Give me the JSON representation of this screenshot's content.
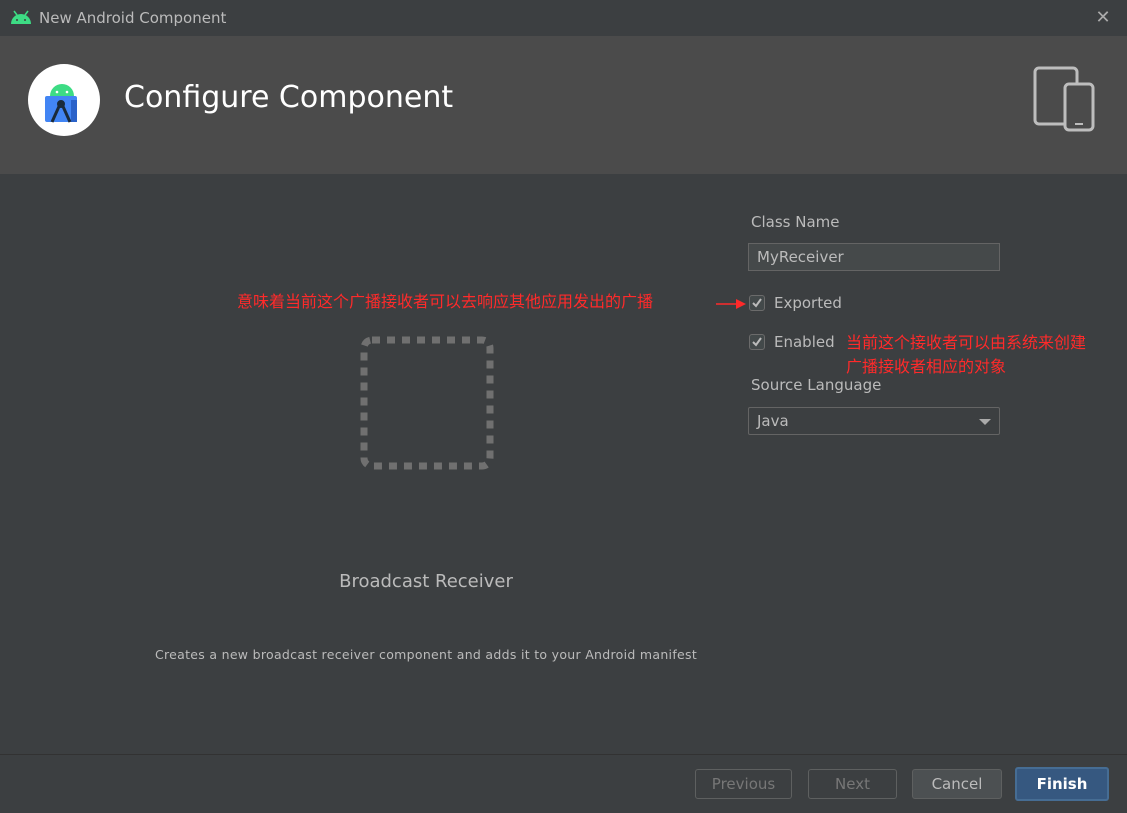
{
  "window": {
    "title": "New Android Component",
    "close_icon": "close-icon"
  },
  "header": {
    "title": "Configure Component"
  },
  "component": {
    "name": "Broadcast Receiver",
    "description": "Creates a new broadcast receiver component and adds it to your Android manifest"
  },
  "form": {
    "class_name_label": "Class Name",
    "class_name_value": "MyReceiver",
    "exported_label": "Exported",
    "exported_checked": true,
    "enabled_label": "Enabled",
    "enabled_checked": true,
    "source_language_label": "Source Language",
    "source_language_value": "Java"
  },
  "annotations": {
    "exported_note": "意味着当前这个广播接收者可以去响应其他应用发出的广播",
    "enabled_note_line1": "当前这个接收者可以由系统来创建",
    "enabled_note_line2": "广播接收者相应的对象",
    "color": "#ff2a2a"
  },
  "footer": {
    "previous": "Previous",
    "next": "Next",
    "cancel": "Cancel",
    "finish": "Finish"
  },
  "colors": {
    "accent": "#365880",
    "android_green": "#3ddc84"
  }
}
